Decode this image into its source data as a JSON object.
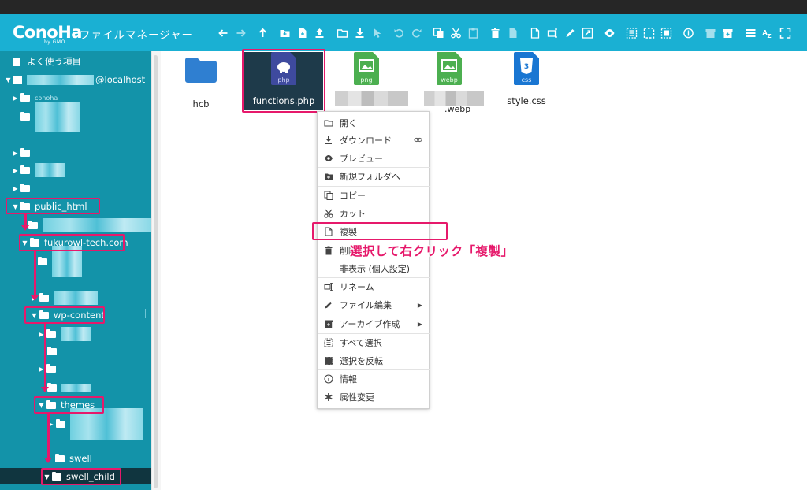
{
  "app": {
    "logo": "ConoHa",
    "logo_sub": "by GMO",
    "title": "ファイルマネージャー"
  },
  "toolbar": {
    "icons": [
      "back-icon",
      "forward-icon",
      "up-icon",
      "new-folder-icon",
      "new-file-icon",
      "upload-icon",
      "open-icon",
      "download-icon",
      "select-cursor-icon",
      "undo-icon",
      "redo-icon",
      "copy-icon",
      "cut-icon",
      "paste-icon",
      "delete-icon",
      "empty-icon",
      "duplicate-icon",
      "rename-icon",
      "edit-icon",
      "resize-icon",
      "preview-icon",
      "select-all-icon",
      "select-none-icon",
      "invert-selection-icon",
      "info-icon",
      "extract-icon",
      "archive-icon",
      "view-list-icon",
      "sort-icon",
      "fullscreen-icon"
    ]
  },
  "tree": {
    "favorites": "よく使う項目",
    "host": "@localhost",
    "partial_label": "conoha",
    "public_html": "public_html",
    "domain": "fukurowl-tech.com",
    "wp_content": "wp-content",
    "themes": "themes",
    "swell": "swell",
    "swell_child": "swell_child"
  },
  "files": [
    {
      "name": "hcb",
      "kind": "folder"
    },
    {
      "name": "functions.php",
      "kind": "php",
      "badge": "php",
      "selected": true
    },
    {
      "name": "",
      "kind": "png",
      "badge": "png"
    },
    {
      "name": ".webp",
      "kind": "webp",
      "badge": "webp"
    },
    {
      "name": "style.css",
      "kind": "css",
      "badge": "css"
    }
  ],
  "context_menu": {
    "open": "開く",
    "download": "ダウンロード",
    "preview": "プレビュー",
    "to_new_folder": "新規フォルダへ",
    "copy": "コピー",
    "cut": "カット",
    "duplicate": "複製",
    "delete": "削除",
    "hide": "非表示 (個人設定)",
    "rename": "リネーム",
    "edit": "ファイル編集",
    "archive": "アーカイブ作成",
    "select_all": "すべて選択",
    "invert": "選択を反転",
    "info": "情報",
    "chmod": "属性変更"
  },
  "annotation": "選択して右クリック「複製」",
  "colors": {
    "header": "#1ab0d3",
    "sidebar": "#1393a9",
    "highlight": "#e6196b",
    "folder": "#2f7fd1",
    "php": "#3e4a9e",
    "png": "#4caf50",
    "css": "#1976d2"
  }
}
